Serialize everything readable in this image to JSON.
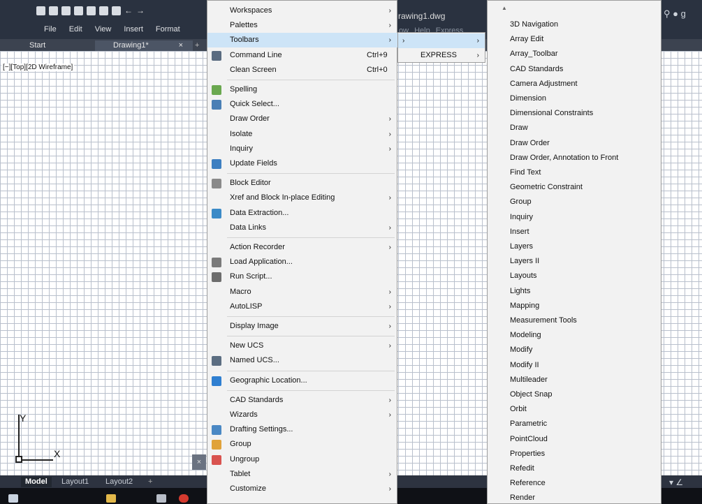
{
  "window": {
    "file_title": "rawing1.dwg",
    "hidden_menu": [
      "ow",
      "Help",
      "Express"
    ],
    "right_user": "g"
  },
  "menubar": [
    "File",
    "Edit",
    "View",
    "Insert",
    "Format"
  ],
  "tabs": {
    "start": "Start",
    "drawing": "Drawing1*",
    "close": "×",
    "plus": "+"
  },
  "viewport_label": "[−][Top][2D Wireframe]",
  "ucs": {
    "x": "X",
    "y": "Y"
  },
  "layout_tabs": [
    "Model",
    "Layout1",
    "Layout2",
    "+"
  ],
  "tools_menu": {
    "items": [
      {
        "label": "Workspaces",
        "submenu": true
      },
      {
        "label": "Palettes",
        "submenu": true
      },
      {
        "label": "Toolbars",
        "submenu": true,
        "highlight": true
      },
      {
        "label": "Command Line",
        "shortcut": "Ctrl+9",
        "icon": "command-line-icon",
        "icon_color": "#5a6b80"
      },
      {
        "label": "Clean Screen",
        "shortcut": "Ctrl+0"
      },
      {
        "sep": true
      },
      {
        "label": "Spelling",
        "icon": "spelling-icon",
        "icon_color": "#6aa84f"
      },
      {
        "label": "Quick Select...",
        "icon": "quick-select-icon",
        "icon_color": "#4a7fb5"
      },
      {
        "label": "Draw Order",
        "submenu": true
      },
      {
        "label": "Isolate",
        "submenu": true
      },
      {
        "label": "Inquiry",
        "submenu": true
      },
      {
        "label": "Update Fields",
        "icon": "update-fields-icon",
        "icon_color": "#3d7fc1"
      },
      {
        "sep": true
      },
      {
        "label": "Block Editor",
        "icon": "block-editor-icon",
        "icon_color": "#8a8a8a"
      },
      {
        "label": "Xref and Block In-place Editing",
        "submenu": true
      },
      {
        "label": "Data Extraction...",
        "icon": "data-extraction-icon",
        "icon_color": "#3b8ac7"
      },
      {
        "label": "Data Links",
        "submenu": true
      },
      {
        "sep": true
      },
      {
        "label": "Action Recorder",
        "submenu": true
      },
      {
        "label": "Load Application...",
        "icon": "load-application-icon",
        "icon_color": "#7a7a7a"
      },
      {
        "label": "Run Script...",
        "icon": "run-script-icon",
        "icon_color": "#6d6d6d"
      },
      {
        "label": "Macro",
        "submenu": true
      },
      {
        "label": "AutoLISP",
        "submenu": true
      },
      {
        "sep": true
      },
      {
        "label": "Display Image",
        "submenu": true
      },
      {
        "sep": true
      },
      {
        "label": "New UCS",
        "submenu": true
      },
      {
        "label": "Named UCS...",
        "icon": "named-ucs-icon",
        "icon_color": "#5c6e82"
      },
      {
        "sep": true
      },
      {
        "label": "Geographic Location...",
        "icon": "globe-icon",
        "icon_color": "#2f7fd1"
      },
      {
        "sep": true
      },
      {
        "label": "CAD Standards",
        "submenu": true
      },
      {
        "label": "Wizards",
        "submenu": true
      },
      {
        "label": "Drafting Settings...",
        "icon": "drafting-settings-icon",
        "icon_color": "#4a88c4"
      },
      {
        "label": "Group",
        "icon": "group-icon",
        "icon_color": "#e0a23a"
      },
      {
        "label": "Ungroup",
        "icon": "ungroup-icon",
        "icon_color": "#d9534f"
      },
      {
        "label": "Tablet",
        "submenu": true
      },
      {
        "label": "Customize",
        "submenu": true
      }
    ]
  },
  "toolbars_submenu": {
    "items": [
      {
        "label": "",
        "submenu": true,
        "highlight": true
      },
      {
        "label": "EXPRESS",
        "submenu": true
      }
    ]
  },
  "autocad_toolbars": {
    "items": [
      "3D Navigation",
      "Array Edit",
      "Array_Toolbar",
      "CAD Standards",
      "Camera Adjustment",
      "Dimension",
      "Dimensional Constraints",
      "Draw",
      "Draw Order",
      "Draw Order, Annotation to Front",
      "Find Text",
      "Geometric Constraint",
      "Group",
      "Inquiry",
      "Insert",
      "Layers",
      "Layers II",
      "Layouts",
      "Lights",
      "Mapping",
      "Measurement Tools",
      "Modeling",
      "Modify",
      "Modify II",
      "Multileader",
      "Object Snap",
      "Orbit",
      "Parametric",
      "PointCloud",
      "Properties",
      "Refedit",
      "Reference",
      "Render"
    ]
  }
}
